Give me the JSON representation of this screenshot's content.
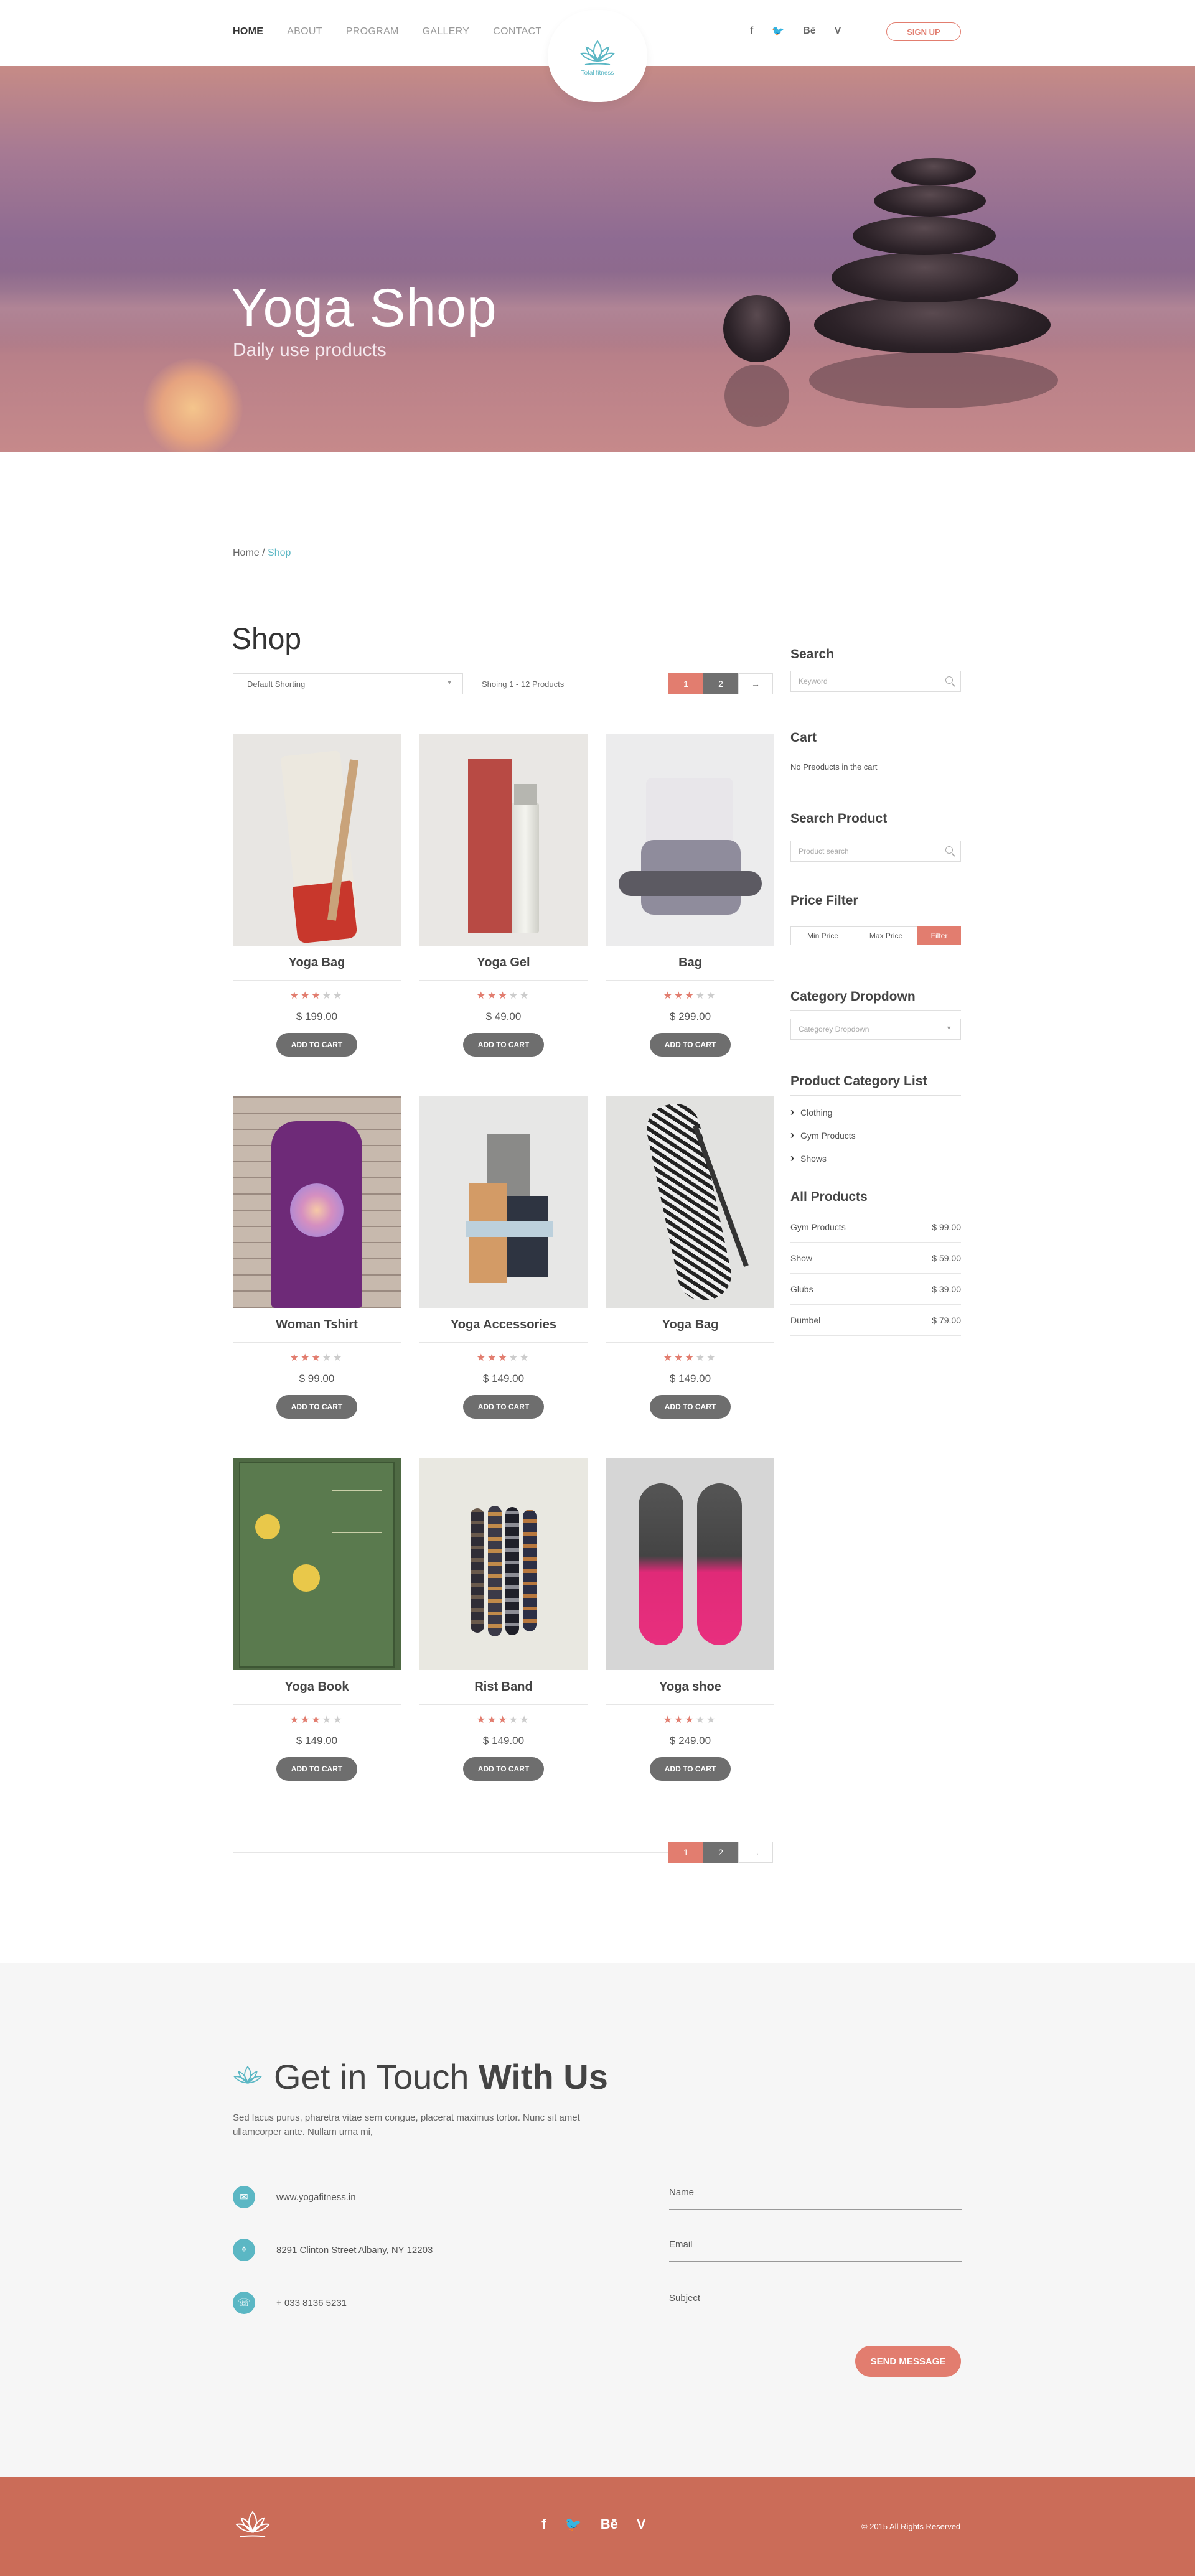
{
  "nav": {
    "items": [
      "HOME",
      "ABOUT",
      "PROGRAM",
      "GALLERY",
      "CONTACT"
    ],
    "signup_label": "SIGN UP",
    "social": [
      "f",
      "🐦",
      "Bē",
      "V"
    ]
  },
  "logo": {
    "text": "Total fitness"
  },
  "hero": {
    "title": "Yoga Shop",
    "subtitle": "Daily use products"
  },
  "breadcrumb": {
    "home": "Home /",
    "current": " Shop"
  },
  "shop": {
    "title": "Shop",
    "sort_label": "Default Shorting",
    "showing": "Shoing 1 - 12 Products",
    "pages": [
      "1",
      "2"
    ],
    "next": "→",
    "add_to_cart": "ADD TO CART",
    "products": [
      {
        "name": "Yoga Bag",
        "price": "$ 199.00",
        "rating": 3
      },
      {
        "name": "Yoga Gel",
        "price": "$ 49.00",
        "rating": 3
      },
      {
        "name": "Bag",
        "price": "$ 299.00",
        "rating": 3
      },
      {
        "name": "Woman Tshirt",
        "price": "$ 99.00",
        "rating": 3
      },
      {
        "name": "Yoga Accessories",
        "price": "$ 149.00",
        "rating": 3
      },
      {
        "name": "Yoga Bag",
        "price": "$ 149.00",
        "rating": 3
      },
      {
        "name": "Yoga Book",
        "price": "$ 149.00",
        "rating": 3
      },
      {
        "name": "Rist Band",
        "price": "$ 149.00",
        "rating": 3
      },
      {
        "name": "Yoga shoe",
        "price": "$ 249.00",
        "rating": 3
      }
    ]
  },
  "sidebar": {
    "search": {
      "title": "Search",
      "placeholder": "Keyword"
    },
    "cart": {
      "title": "Cart",
      "text": "No Preoducts in the cart"
    },
    "search_product": {
      "title": "Search Product",
      "placeholder": "Product search"
    },
    "price_filter": {
      "title": "Price Filter",
      "min": "Min Price",
      "max": "Max Price",
      "filter": "Filter"
    },
    "category_dropdown": {
      "title": "Category Dropdown",
      "placeholder": "Categorey Dropdown"
    },
    "category_list": {
      "title": "Product Category List",
      "items": [
        "Clothing",
        "Gym Products",
        "Shows"
      ]
    },
    "all_products": {
      "title": "All Products",
      "items": [
        {
          "name": "Gym Products",
          "price": "$ 99.00"
        },
        {
          "name": "Show",
          "price": "$ 59.00"
        },
        {
          "name": "Glubs",
          "price": "$ 39.00"
        },
        {
          "name": "Dumbel",
          "price": "$ 79.00"
        }
      ]
    }
  },
  "contact": {
    "title_light": "Get in Touch ",
    "title_bold": "With Us",
    "description": "Sed lacus purus, pharetra vitae sem congue, placerat maximus tortor. Nunc sit amet ullamcorper ante. Nullam urna mi,",
    "website": "www.yogafitness.in",
    "address": "8291 Clinton Street  Albany, NY 12203",
    "phone": "+ 033 8136 5231",
    "fields": [
      "Name",
      "Email",
      "Subject"
    ],
    "send_label": "SEND MESSAGE"
  },
  "footer": {
    "social": [
      "f",
      "🐦",
      "Bē",
      "V"
    ],
    "copyright": "©  2015  All Rights Reserved"
  },
  "colors": {
    "accent": "#e27d6f",
    "teal": "#5bb7c4",
    "footer": "#cb6c58",
    "button": "#6e6e6e"
  }
}
